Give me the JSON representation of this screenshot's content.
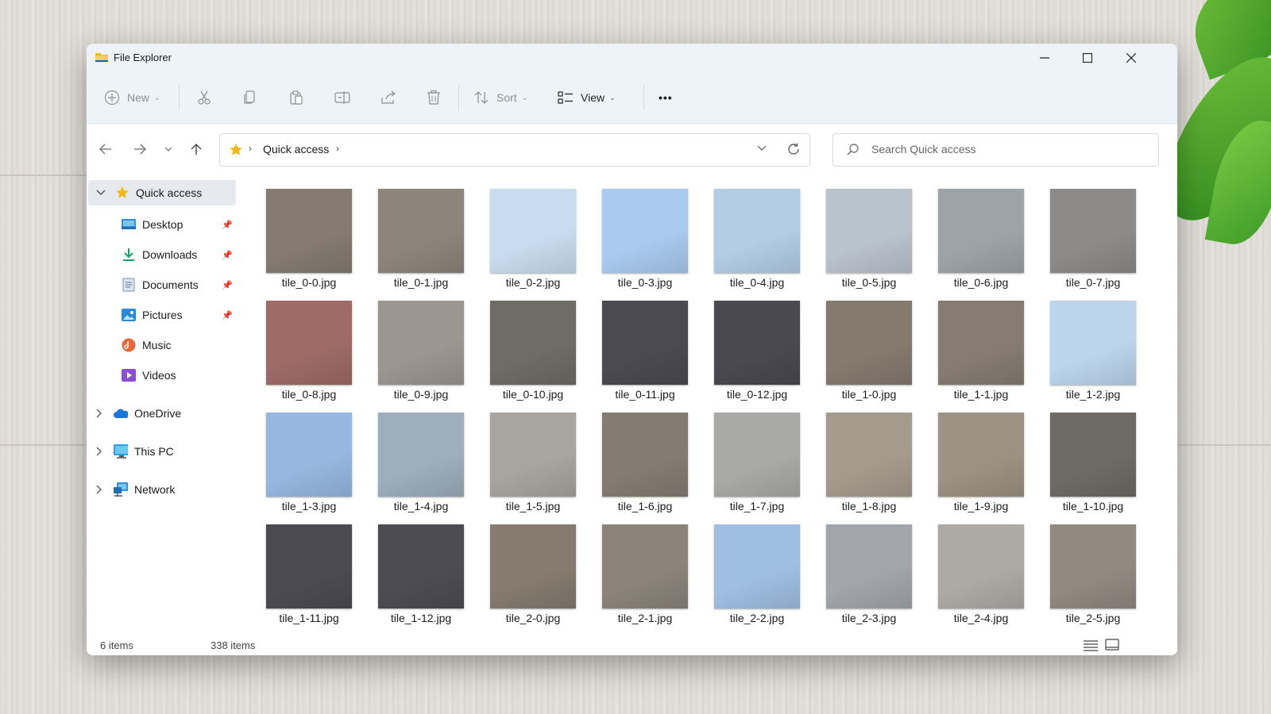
{
  "window": {
    "title": "File Explorer"
  },
  "toolbar": {
    "new_label": "New",
    "sort_label": "Sort",
    "view_label": "View",
    "more_label": "•••"
  },
  "address": {
    "segment": "Quick access",
    "search_placeholder": "Search Quick access"
  },
  "sidebar": {
    "quick_access": "Quick access",
    "items": [
      {
        "label": "Desktop",
        "icon": "desktop-icon",
        "pinned": true
      },
      {
        "label": "Downloads",
        "icon": "downloads-icon",
        "pinned": true
      },
      {
        "label": "Documents",
        "icon": "documents-icon",
        "pinned": true
      },
      {
        "label": "Pictures",
        "icon": "pictures-icon",
        "pinned": true
      },
      {
        "label": "Music",
        "icon": "music-icon",
        "pinned": false
      },
      {
        "label": "Videos",
        "icon": "videos-icon",
        "pinned": false
      }
    ],
    "roots": [
      {
        "label": "OneDrive",
        "icon": "onedrive-icon"
      },
      {
        "label": "This PC",
        "icon": "this-pc-icon"
      },
      {
        "label": "Network",
        "icon": "network-icon"
      }
    ]
  },
  "files": [
    {
      "name": "tile_0-0.jpg",
      "thumb": "#857b70"
    },
    {
      "name": "tile_0-1.jpg",
      "thumb": "#8e857a"
    },
    {
      "name": "tile_0-2.jpg",
      "thumb": "#c9dcef"
    },
    {
      "name": "tile_0-3.jpg",
      "thumb": "#a9cbef"
    },
    {
      "name": "tile_0-4.jpg",
      "thumb": "#b3cde6"
    },
    {
      "name": "tile_0-5.jpg",
      "thumb": "#b9c3cc"
    },
    {
      "name": "tile_0-6.jpg",
      "thumb": "#9ea3a7"
    },
    {
      "name": "tile_0-7.jpg",
      "thumb": "#8c8b8a"
    },
    {
      "name": "tile_0-8.jpg",
      "thumb": "#9e6b66"
    },
    {
      "name": "tile_0-9.jpg",
      "thumb": "#9b9690"
    },
    {
      "name": "tile_0-10.jpg",
      "thumb": "#6f6b67"
    },
    {
      "name": "tile_0-11.jpg",
      "thumb": "#4b4a50"
    },
    {
      "name": "tile_0-12.jpg",
      "thumb": "#4a4950"
    },
    {
      "name": "tile_1-0.jpg",
      "thumb": "#857a6e"
    },
    {
      "name": "tile_1-1.jpg",
      "thumb": "#867c71"
    },
    {
      "name": "tile_1-2.jpg",
      "thumb": "#bcd4ee"
    },
    {
      "name": "tile_1-3.jpg",
      "thumb": "#96b8e0"
    },
    {
      "name": "tile_1-4.jpg",
      "thumb": "#9eaebc"
    },
    {
      "name": "tile_1-5.jpg",
      "thumb": "#a8a49f"
    },
    {
      "name": "tile_1-6.jpg",
      "thumb": "#857c71"
    },
    {
      "name": "tile_1-7.jpg",
      "thumb": "#a9aaa8"
    },
    {
      "name": "tile_1-8.jpg",
      "thumb": "#a59b8d"
    },
    {
      "name": "tile_1-9.jpg",
      "thumb": "#9c9283"
    },
    {
      "name": "tile_1-10.jpg",
      "thumb": "#6e6a66"
    },
    {
      "name": "tile_1-11.jpg",
      "thumb": "#4c4b51"
    },
    {
      "name": "tile_1-12.jpg",
      "thumb": "#4d4c52"
    },
    {
      "name": "tile_2-0.jpg",
      "thumb": "#857b6f"
    },
    {
      "name": "tile_2-1.jpg",
      "thumb": "#8c8479"
    },
    {
      "name": "tile_2-2.jpg",
      "thumb": "#9fbfe2"
    },
    {
      "name": "tile_2-3.jpg",
      "thumb": "#a2a6aa"
    },
    {
      "name": "tile_2-4.jpg",
      "thumb": "#adaaa6"
    },
    {
      "name": "tile_2-5.jpg",
      "thumb": "#928980"
    }
  ],
  "status": {
    "selected": "6 items",
    "total": "338 items"
  },
  "colors": {
    "accent": "#0067c0",
    "folder_yellow": "#f3b81c",
    "chrome_bg": "#eef3f9"
  }
}
